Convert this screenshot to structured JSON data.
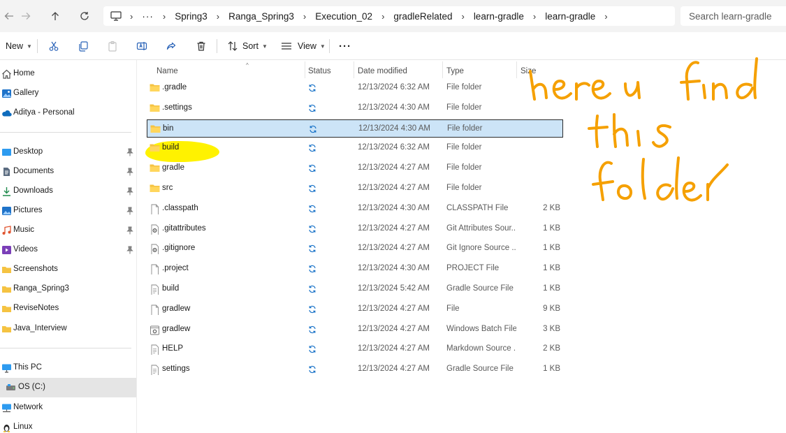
{
  "address_bar": {
    "more_label": "···",
    "path": [
      "Spring3",
      "Ranga_Spring3",
      "Execution_02",
      "gradleRelated",
      "learn-gradle",
      "learn-gradle"
    ],
    "search_placeholder": "Search learn-gradle"
  },
  "toolbar": {
    "new_label": "New",
    "sort_label": "Sort",
    "view_label": "View",
    "more_label": "···"
  },
  "sidebar": {
    "items": [
      {
        "label": "Home",
        "icon": "home-icon"
      },
      {
        "label": "Gallery",
        "icon": "gallery-icon"
      },
      {
        "label": "Aditya - Personal",
        "icon": "onedrive-cloud-icon"
      },
      {
        "label": "Desktop",
        "icon": "desktop-icon",
        "pinned": true
      },
      {
        "label": "Documents",
        "icon": "documents-icon",
        "pinned": true
      },
      {
        "label": "Downloads",
        "icon": "downloads-icon",
        "pinned": true
      },
      {
        "label": "Pictures",
        "icon": "pictures-icon",
        "pinned": true
      },
      {
        "label": "Music",
        "icon": "music-icon",
        "pinned": true
      },
      {
        "label": "Videos",
        "icon": "videos-icon",
        "pinned": true
      },
      {
        "label": "Screenshots",
        "icon": "folder-icon"
      },
      {
        "label": "Ranga_Spring3",
        "icon": "folder-icon"
      },
      {
        "label": "ReviseNotes",
        "icon": "folder-icon"
      },
      {
        "label": "Java_Interview",
        "icon": "folder-icon"
      },
      {
        "label": "This PC",
        "icon": "this-pc-icon"
      },
      {
        "label": "OS (C:)",
        "icon": "drive-icon",
        "selected": true
      },
      {
        "label": "Network",
        "icon": "network-icon"
      },
      {
        "label": "Linux",
        "icon": "linux-icon"
      }
    ]
  },
  "columns": {
    "name": "Name",
    "status": "Status",
    "date": "Date modified",
    "type": "Type",
    "size": "Size"
  },
  "files": [
    {
      "name": ".gradle",
      "date": "12/13/2024 6:32 AM",
      "type": "File folder",
      "size": "",
      "icon": "folder-icon"
    },
    {
      "name": ".settings",
      "date": "12/13/2024 4:30 AM",
      "type": "File folder",
      "size": "",
      "icon": "folder-icon"
    },
    {
      "name": "bin",
      "date": "12/13/2024 4:30 AM",
      "type": "File folder",
      "size": "",
      "icon": "folder-icon",
      "selected": true
    },
    {
      "name": "build",
      "date": "12/13/2024 6:32 AM",
      "type": "File folder",
      "size": "",
      "icon": "folder-icon",
      "highlighted": true
    },
    {
      "name": "gradle",
      "date": "12/13/2024 4:27 AM",
      "type": "File folder",
      "size": "",
      "icon": "folder-icon"
    },
    {
      "name": "src",
      "date": "12/13/2024 4:27 AM",
      "type": "File folder",
      "size": "",
      "icon": "folder-icon"
    },
    {
      "name": ".classpath",
      "date": "12/13/2024 4:30 AM",
      "type": "CLASSPATH File",
      "size": "2 KB",
      "icon": "file-icon"
    },
    {
      "name": ".gitattributes",
      "date": "12/13/2024 4:27 AM",
      "type": "Git Attributes Sour...",
      "size": "1 KB",
      "icon": "settings-file-icon"
    },
    {
      "name": ".gitignore",
      "date": "12/13/2024 4:27 AM",
      "type": "Git Ignore Source ...",
      "size": "1 KB",
      "icon": "settings-file-icon"
    },
    {
      "name": ".project",
      "date": "12/13/2024 4:30 AM",
      "type": "PROJECT File",
      "size": "1 KB",
      "icon": "file-icon"
    },
    {
      "name": "build",
      "date": "12/13/2024 5:42 AM",
      "type": "Gradle Source File",
      "size": "1 KB",
      "icon": "text-file-icon"
    },
    {
      "name": "gradlew",
      "date": "12/13/2024 4:27 AM",
      "type": "File",
      "size": "9 KB",
      "icon": "file-icon"
    },
    {
      "name": "gradlew",
      "date": "12/13/2024 4:27 AM",
      "type": "Windows Batch File",
      "size": "3 KB",
      "icon": "batch-file-icon"
    },
    {
      "name": "HELP",
      "date": "12/13/2024 4:27 AM",
      "type": "Markdown Source ...",
      "size": "2 KB",
      "icon": "text-file-icon"
    },
    {
      "name": "settings",
      "date": "12/13/2024 4:27 AM",
      "type": "Gradle Source File",
      "size": "1 KB",
      "icon": "text-file-icon"
    }
  ],
  "annotation": {
    "lines": [
      "here u find",
      "this",
      "folder"
    ],
    "ink_color": "#f5a000",
    "highlight_color": "#fff200"
  },
  "colors": {
    "folder": "#f5c342",
    "selection_bg": "#cce4f7",
    "sync_icon": "#1a73c8"
  }
}
